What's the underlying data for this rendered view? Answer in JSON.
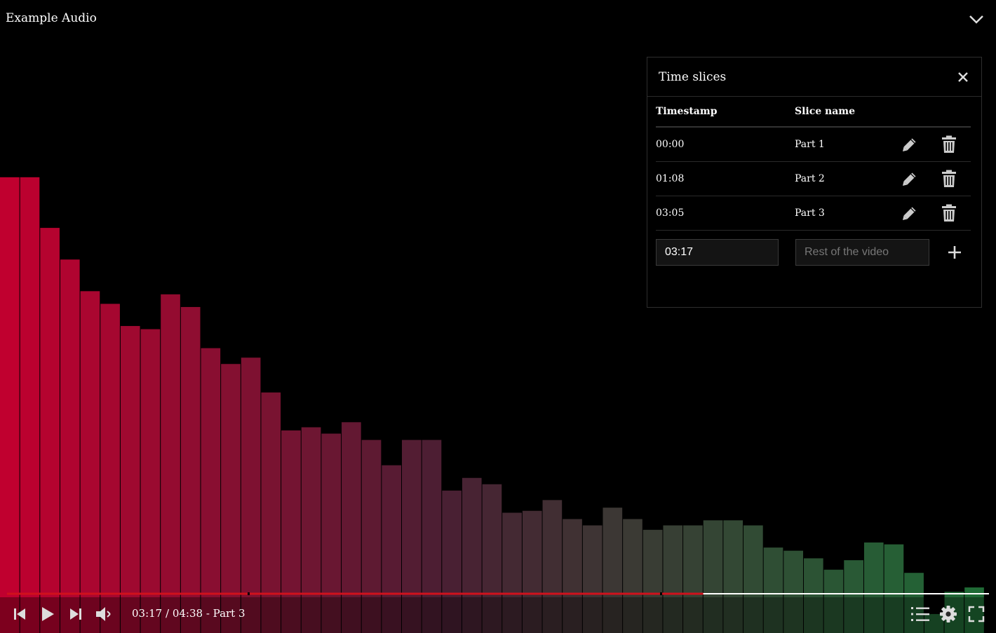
{
  "app": {
    "title": "Example Audio",
    "collapse_icon": "chevron-down-icon"
  },
  "time_slices_panel": {
    "title": "Time slices",
    "close_icon": "close-icon",
    "columns": {
      "timestamp": "Timestamp",
      "slice_name": "Slice name"
    },
    "rows": [
      {
        "timestamp": "00:00",
        "name": "Part 1"
      },
      {
        "timestamp": "01:08",
        "name": "Part 2"
      },
      {
        "timestamp": "03:05",
        "name": "Part 3"
      }
    ],
    "row_icons": {
      "edit": "pencil-icon",
      "delete": "trash-icon"
    },
    "new_slice": {
      "timestamp_value": "03:17",
      "name_placeholder": "Rest of the video",
      "add_icon": "plus-icon"
    }
  },
  "player": {
    "time_display": "03:17 / 04:38 - Part 3",
    "current_time": "03:17",
    "duration": "04:38",
    "current_part": "Part 3",
    "progress_fraction": 0.709,
    "chapter_markers_fraction": [
      0.245,
      0.665
    ],
    "colors": {
      "played": "#d0111c",
      "unplayed": "#ffffff"
    },
    "icons": [
      "skip-back-icon",
      "play-icon",
      "skip-forward-icon",
      "volume-icon",
      "chapters-icon",
      "gear-icon",
      "fullscreen-icon"
    ]
  },
  "visualizer": {
    "levels": [
      0.72,
      0.72,
      0.64,
      0.59,
      0.54,
      0.52,
      0.485,
      0.48,
      0.535,
      0.515,
      0.45,
      0.425,
      0.435,
      0.38,
      0.32,
      0.325,
      0.315,
      0.333,
      0.305,
      0.265,
      0.305,
      0.305,
      0.225,
      0.245,
      0.235,
      0.19,
      0.193,
      0.21,
      0.18,
      0.17,
      0.198,
      0.18,
      0.163,
      0.17,
      0.17,
      0.178,
      0.178,
      0.17,
      0.135,
      0.13,
      0.118,
      0.1,
      0.115,
      0.143,
      0.14,
      0.095,
      0.03,
      0.065,
      0.072
    ],
    "color_start": "#c0002f",
    "color_mid": "#4a1f33",
    "color_end": "#1f6a35"
  }
}
